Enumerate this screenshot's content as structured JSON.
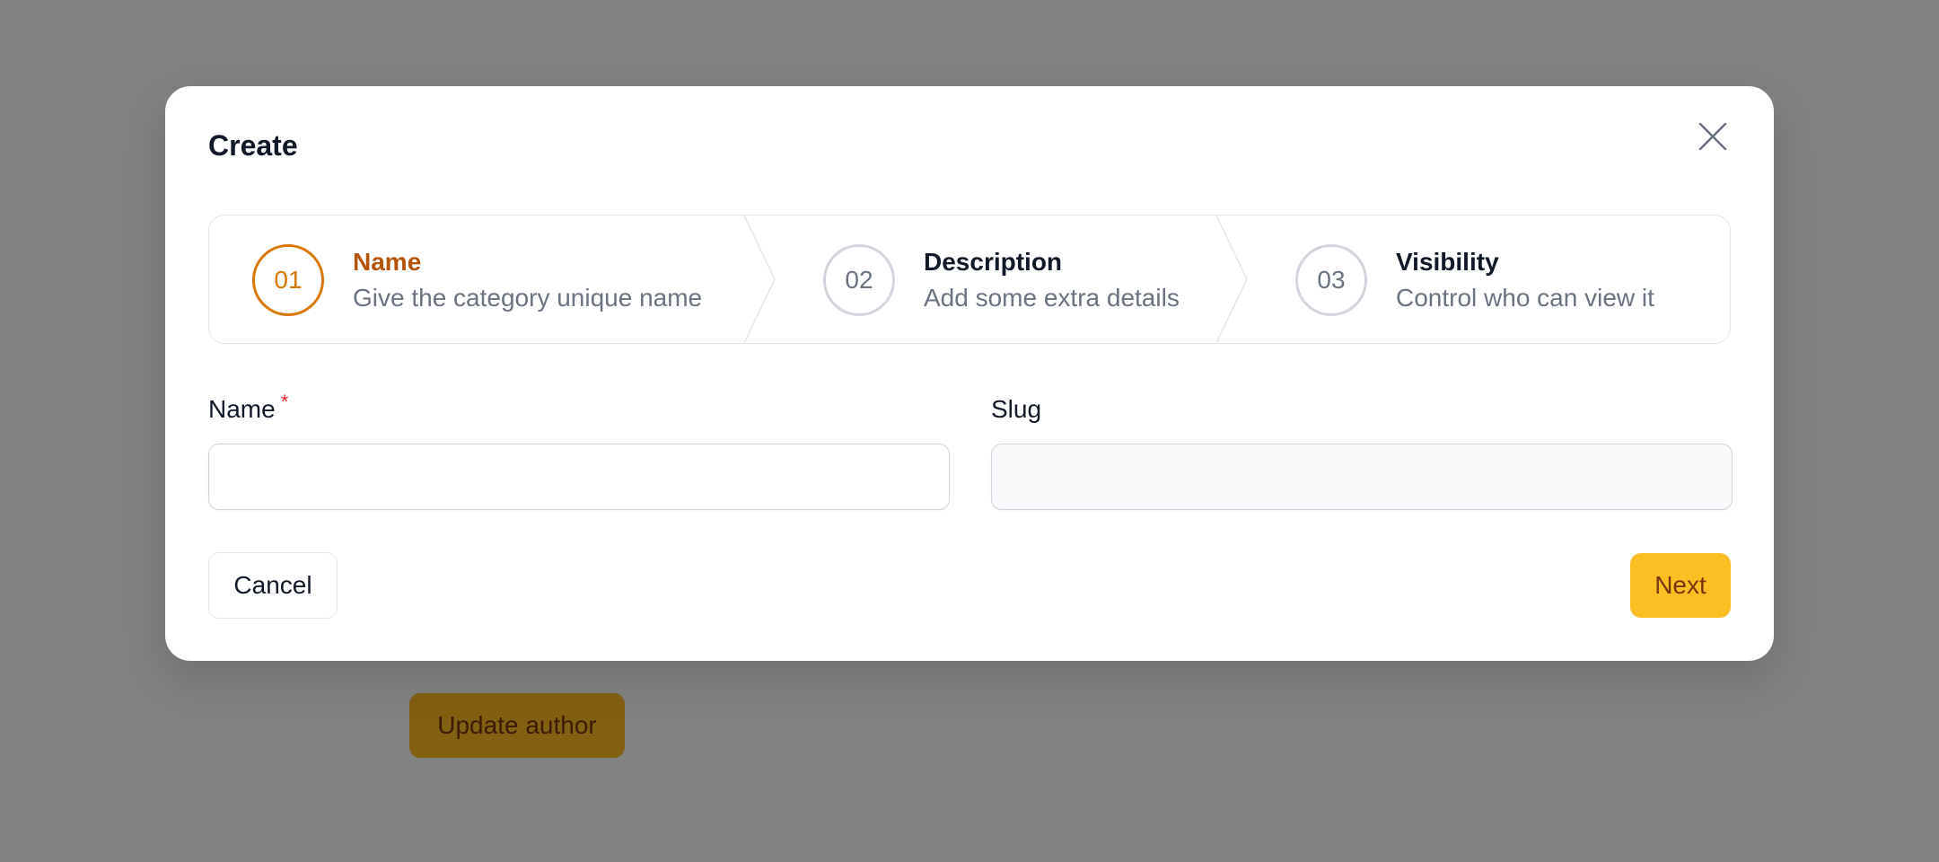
{
  "background": {
    "update_author_label": "Update author"
  },
  "modal": {
    "title": "Create",
    "close_icon": "close-icon",
    "steps": [
      {
        "number": "01",
        "title": "Name",
        "description": "Give the category unique name",
        "active": true
      },
      {
        "number": "02",
        "title": "Description",
        "description": "Add some extra details",
        "active": false
      },
      {
        "number": "03",
        "title": "Visibility",
        "description": "Control who can view it",
        "active": false
      }
    ],
    "fields": {
      "name": {
        "label": "Name",
        "required_mark": "*",
        "value": "",
        "placeholder": ""
      },
      "slug": {
        "label": "Slug",
        "value": "",
        "placeholder": ""
      }
    },
    "cancel_label": "Cancel",
    "next_label": "Next"
  },
  "colors": {
    "accent": "#fbbf24",
    "accent_text": "#78350f",
    "active_step": "#d97706",
    "required": "#dc2626",
    "overlay": "rgba(0,0,0,0.49)"
  }
}
